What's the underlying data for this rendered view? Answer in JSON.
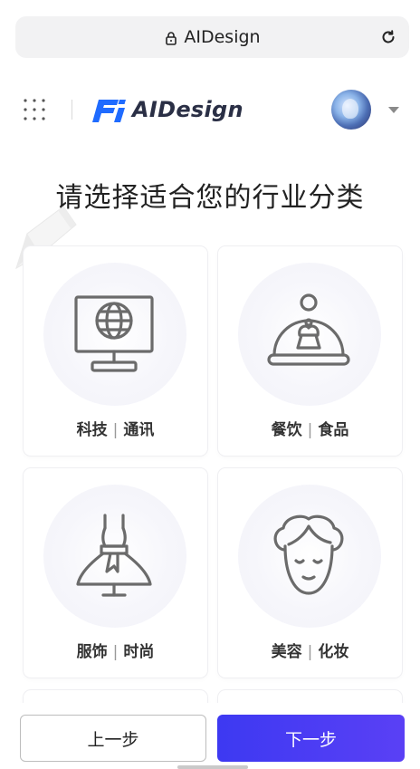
{
  "browser": {
    "url": "AIDesign",
    "lock_icon": "lock-icon",
    "reload_icon": "reload-icon"
  },
  "header": {
    "apps_icon": "grid-dots-icon",
    "logo_text": "AIDesign",
    "brand_color": "#1f6bff"
  },
  "title": "请选择适合您的行业分类",
  "categories": [
    {
      "label_a": "科技",
      "label_b": "通讯",
      "icon": "monitor-globe-icon"
    },
    {
      "label_a": "餐饮",
      "label_b": "食品",
      "icon": "food-cloche-icon"
    },
    {
      "label_a": "服饰",
      "label_b": "时尚",
      "icon": "dress-icon"
    },
    {
      "label_a": "美容",
      "label_b": "化妆",
      "icon": "face-icon"
    }
  ],
  "separator": "|",
  "buttons": {
    "prev": "上一步",
    "next": "下一步"
  },
  "colors": {
    "accent": "#4a3cf4",
    "card_border": "#efeff2"
  }
}
